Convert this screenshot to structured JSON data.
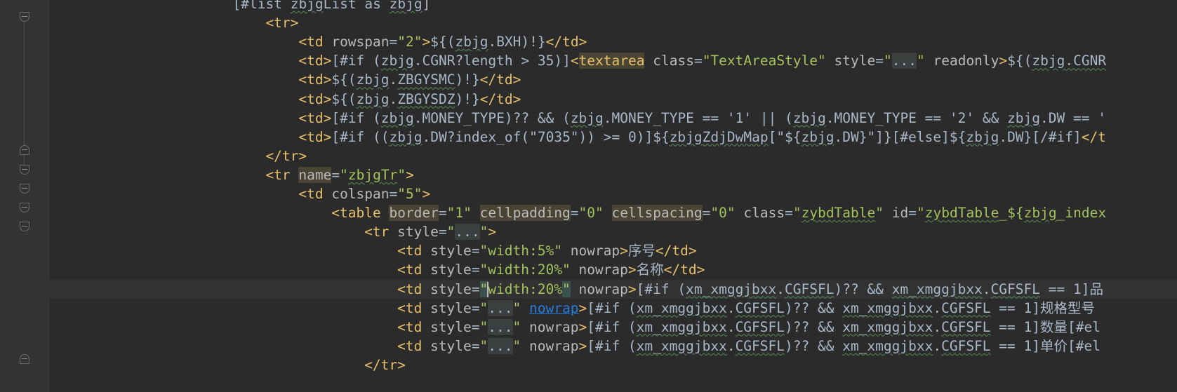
{
  "editor": {
    "lines": [
      {
        "indent": 12,
        "segments": [
          {
            "t": "[#list ",
            "c": "txt"
          },
          {
            "t": "zbjg",
            "c": "txt wavy"
          },
          {
            "t": "List as ",
            "c": "txt"
          },
          {
            "t": "zbjg",
            "c": "txt wavy"
          },
          {
            "t": "]",
            "c": "txt"
          }
        ]
      },
      {
        "indent": 14,
        "segments": [
          {
            "t": "<tr>",
            "c": "tag"
          }
        ]
      },
      {
        "indent": 16,
        "segments": [
          {
            "t": "<td ",
            "c": "tag"
          },
          {
            "t": "rowspan",
            "c": "attr"
          },
          {
            "t": "=",
            "c": "txt"
          },
          {
            "t": "\"2\"",
            "c": "str"
          },
          {
            "t": ">",
            "c": "tag"
          },
          {
            "t": "${(",
            "c": "txt"
          },
          {
            "t": "zbjg",
            "c": "txt wavy"
          },
          {
            "t": ".BXH)!}",
            "c": "txt"
          },
          {
            "t": "</td>",
            "c": "tag"
          }
        ]
      },
      {
        "indent": 16,
        "segments": [
          {
            "t": "<td>",
            "c": "tag"
          },
          {
            "t": "[#if (",
            "c": "txt"
          },
          {
            "t": "zbjg",
            "c": "txt wavy"
          },
          {
            "t": ".CGNR?length > 35)]",
            "c": "txt"
          },
          {
            "t": "<",
            "c": "tag"
          },
          {
            "t": "textarea",
            "c": "tag hl"
          },
          {
            "t": " ",
            "c": "tag"
          },
          {
            "t": "class",
            "c": "attr"
          },
          {
            "t": "=",
            "c": "txt"
          },
          {
            "t": "\"TextAreaStyle\"",
            "c": "str"
          },
          {
            "t": " ",
            "c": "txt"
          },
          {
            "t": "style",
            "c": "attr"
          },
          {
            "t": "=",
            "c": "txt"
          },
          {
            "t": "\"",
            "c": "str"
          },
          {
            "t": "...",
            "c": "fold-ph"
          },
          {
            "t": "\"",
            "c": "str"
          },
          {
            "t": " ",
            "c": "txt"
          },
          {
            "t": "readonly",
            "c": "attr"
          },
          {
            "t": ">",
            "c": "tag"
          },
          {
            "t": "${(",
            "c": "txt"
          },
          {
            "t": "zbjg",
            "c": "txt wavy"
          },
          {
            "t": ".CGNR",
            "c": "txt wavy"
          }
        ]
      },
      {
        "indent": 16,
        "segments": [
          {
            "t": "<td>",
            "c": "tag"
          },
          {
            "t": "${(",
            "c": "txt"
          },
          {
            "t": "zbjg",
            "c": "txt wavy"
          },
          {
            "t": ".",
            "c": "txt"
          },
          {
            "t": "ZBGYSMC",
            "c": "txt wavy"
          },
          {
            "t": ")!}",
            "c": "txt"
          },
          {
            "t": "</td>",
            "c": "tag"
          }
        ]
      },
      {
        "indent": 16,
        "segments": [
          {
            "t": "<td>",
            "c": "tag"
          },
          {
            "t": "${(",
            "c": "txt"
          },
          {
            "t": "zbjg",
            "c": "txt wavy"
          },
          {
            "t": ".",
            "c": "txt"
          },
          {
            "t": "ZBGYSDZ",
            "c": "txt wavy"
          },
          {
            "t": ")!}",
            "c": "txt"
          },
          {
            "t": "</td>",
            "c": "tag"
          }
        ]
      },
      {
        "indent": 16,
        "segments": [
          {
            "t": "<td>",
            "c": "tag"
          },
          {
            "t": "[#if (",
            "c": "txt"
          },
          {
            "t": "zbjg",
            "c": "txt wavy"
          },
          {
            "t": ".MONEY_TYPE)?? && (",
            "c": "txt"
          },
          {
            "t": "zbjg",
            "c": "txt wavy"
          },
          {
            "t": ".MONEY_TYPE == '1' || (",
            "c": "txt"
          },
          {
            "t": "zbjg",
            "c": "txt wavy"
          },
          {
            "t": ".MONEY_TYPE == '2' && ",
            "c": "txt"
          },
          {
            "t": "zbjg",
            "c": "txt wavy"
          },
          {
            "t": ".DW == '",
            "c": "txt"
          }
        ]
      },
      {
        "indent": 16,
        "segments": [
          {
            "t": "<td>",
            "c": "tag"
          },
          {
            "t": "[#if ((",
            "c": "txt"
          },
          {
            "t": "zbjg",
            "c": "txt wavy"
          },
          {
            "t": ".DW?index_of(\"7035\")) >= 0)]${",
            "c": "txt"
          },
          {
            "t": "zbjgZdjDwMap",
            "c": "txt wavy"
          },
          {
            "t": "[\"${",
            "c": "txt"
          },
          {
            "t": "zbjg",
            "c": "txt wavy"
          },
          {
            "t": ".DW}\"]}[#else]${",
            "c": "txt"
          },
          {
            "t": "zbjg",
            "c": "txt wavy"
          },
          {
            "t": ".DW}[/#if]",
            "c": "txt"
          },
          {
            "t": "</t",
            "c": "tag"
          }
        ]
      },
      {
        "indent": 14,
        "segments": [
          {
            "t": "</tr>",
            "c": "tag"
          }
        ]
      },
      {
        "indent": 14,
        "segments": [
          {
            "t": "<tr ",
            "c": "tag"
          },
          {
            "t": "name",
            "c": "attr hl"
          },
          {
            "t": "=",
            "c": "txt"
          },
          {
            "t": "\"",
            "c": "str"
          },
          {
            "t": "zbjgTr",
            "c": "str wavy"
          },
          {
            "t": "\"",
            "c": "str"
          },
          {
            "t": ">",
            "c": "tag"
          }
        ]
      },
      {
        "indent": 16,
        "segments": [
          {
            "t": "<td ",
            "c": "tag"
          },
          {
            "t": "colspan",
            "c": "attr"
          },
          {
            "t": "=",
            "c": "txt"
          },
          {
            "t": "\"5\"",
            "c": "str"
          },
          {
            "t": ">",
            "c": "tag"
          }
        ]
      },
      {
        "indent": 18,
        "segments": [
          {
            "t": "<table ",
            "c": "tag"
          },
          {
            "t": "border",
            "c": "attr hl"
          },
          {
            "t": "=",
            "c": "txt"
          },
          {
            "t": "\"1\"",
            "c": "str"
          },
          {
            "t": " ",
            "c": "txt"
          },
          {
            "t": "cellpadding",
            "c": "attr hl"
          },
          {
            "t": "=",
            "c": "txt"
          },
          {
            "t": "\"0\"",
            "c": "str"
          },
          {
            "t": " ",
            "c": "txt"
          },
          {
            "t": "cellspacing",
            "c": "attr hl"
          },
          {
            "t": "=",
            "c": "txt"
          },
          {
            "t": "\"0\"",
            "c": "str"
          },
          {
            "t": " ",
            "c": "txt"
          },
          {
            "t": "class",
            "c": "attr"
          },
          {
            "t": "=",
            "c": "txt"
          },
          {
            "t": "\"",
            "c": "str"
          },
          {
            "t": "zybdTable",
            "c": "str wavy"
          },
          {
            "t": "\"",
            "c": "str"
          },
          {
            "t": " ",
            "c": "txt"
          },
          {
            "t": "id",
            "c": "attr"
          },
          {
            "t": "=",
            "c": "txt"
          },
          {
            "t": "\"",
            "c": "str"
          },
          {
            "t": "zybdTable",
            "c": "str wavy"
          },
          {
            "t": "_${",
            "c": "str"
          },
          {
            "t": "zbjg",
            "c": "str wavy"
          },
          {
            "t": "_index",
            "c": "str"
          }
        ]
      },
      {
        "indent": 20,
        "segments": [
          {
            "t": "<tr ",
            "c": "tag"
          },
          {
            "t": "style",
            "c": "attr"
          },
          {
            "t": "=",
            "c": "txt"
          },
          {
            "t": "\"",
            "c": "str"
          },
          {
            "t": "...",
            "c": "fold-ph"
          },
          {
            "t": "\"",
            "c": "str"
          },
          {
            "t": ">",
            "c": "tag"
          }
        ]
      },
      {
        "indent": 22,
        "segments": [
          {
            "t": "<td ",
            "c": "tag"
          },
          {
            "t": "style",
            "c": "attr"
          },
          {
            "t": "=",
            "c": "txt"
          },
          {
            "t": "\"width:",
            "c": "str"
          },
          {
            "t": "5%",
            "c": "str"
          },
          {
            "t": "\"",
            "c": "str"
          },
          {
            "t": " ",
            "c": "txt"
          },
          {
            "t": "nowrap",
            "c": "attr"
          },
          {
            "t": ">",
            "c": "tag"
          },
          {
            "t": "序号",
            "c": "txt"
          },
          {
            "t": "</td>",
            "c": "tag"
          }
        ]
      },
      {
        "indent": 22,
        "segments": [
          {
            "t": "<td ",
            "c": "tag"
          },
          {
            "t": "style",
            "c": "attr"
          },
          {
            "t": "=",
            "c": "txt"
          },
          {
            "t": "\"width:",
            "c": "str"
          },
          {
            "t": "20%",
            "c": "str"
          },
          {
            "t": "\"",
            "c": "str"
          },
          {
            "t": " ",
            "c": "txt"
          },
          {
            "t": "nowrap",
            "c": "attr"
          },
          {
            "t": ">",
            "c": "tag"
          },
          {
            "t": "名称",
            "c": "txt"
          },
          {
            "t": "</td>",
            "c": "tag"
          }
        ]
      },
      {
        "indent": 22,
        "current": true,
        "segments": [
          {
            "t": "<td ",
            "c": "tag"
          },
          {
            "t": "style",
            "c": "attr"
          },
          {
            "t": "=",
            "c": "txt"
          },
          {
            "t": "\"",
            "c": "str brace-match"
          },
          {
            "t": "|",
            "c": "cursor"
          },
          {
            "t": "width:",
            "c": "str"
          },
          {
            "t": "20%",
            "c": "str"
          },
          {
            "t": "\"",
            "c": "str brace-match"
          },
          {
            "t": " ",
            "c": "txt"
          },
          {
            "t": "nowrap",
            "c": "attr"
          },
          {
            "t": ">",
            "c": "tag"
          },
          {
            "t": "[#if (",
            "c": "txt"
          },
          {
            "t": "xm_xmggjbxx",
            "c": "txt wavy"
          },
          {
            "t": ".",
            "c": "txt"
          },
          {
            "t": "CGFSFL",
            "c": "txt wavy"
          },
          {
            "t": ")?? && ",
            "c": "txt"
          },
          {
            "t": "xm_xmggjbxx",
            "c": "txt wavy"
          },
          {
            "t": ".",
            "c": "txt"
          },
          {
            "t": "CGFSFL",
            "c": "txt wavy"
          },
          {
            "t": " == 1]品",
            "c": "txt"
          }
        ]
      },
      {
        "indent": 22,
        "segments": [
          {
            "t": "<td ",
            "c": "tag"
          },
          {
            "t": "style",
            "c": "attr"
          },
          {
            "t": "=",
            "c": "txt"
          },
          {
            "t": "\"",
            "c": "str"
          },
          {
            "t": "...",
            "c": "fold-ph"
          },
          {
            "t": "\"",
            "c": "str"
          },
          {
            "t": " ",
            "c": "txt"
          },
          {
            "t": "nowrap",
            "c": "link"
          },
          {
            "t": ">",
            "c": "tag"
          },
          {
            "t": "[#if (",
            "c": "txt"
          },
          {
            "t": "xm_xmggjbxx",
            "c": "txt wavy"
          },
          {
            "t": ".",
            "c": "txt"
          },
          {
            "t": "CGFSFL",
            "c": "txt wavy"
          },
          {
            "t": ")?? && ",
            "c": "txt"
          },
          {
            "t": "xm_xmggjbxx",
            "c": "txt wavy"
          },
          {
            "t": ".",
            "c": "txt"
          },
          {
            "t": "CGFSFL",
            "c": "txt wavy"
          },
          {
            "t": " == 1]规格型号",
            "c": "txt"
          }
        ]
      },
      {
        "indent": 22,
        "segments": [
          {
            "t": "<td ",
            "c": "tag"
          },
          {
            "t": "style",
            "c": "attr"
          },
          {
            "t": "=",
            "c": "txt"
          },
          {
            "t": "\"",
            "c": "str"
          },
          {
            "t": "...",
            "c": "fold-ph"
          },
          {
            "t": "\"",
            "c": "str"
          },
          {
            "t": " ",
            "c": "txt"
          },
          {
            "t": "nowrap",
            "c": "attr"
          },
          {
            "t": ">",
            "c": "tag"
          },
          {
            "t": "[#if (",
            "c": "txt"
          },
          {
            "t": "xm_xmggjbxx",
            "c": "txt wavy"
          },
          {
            "t": ".",
            "c": "txt"
          },
          {
            "t": "CGFSFL",
            "c": "txt wavy"
          },
          {
            "t": ")?? && ",
            "c": "txt"
          },
          {
            "t": "xm_xmggjbxx",
            "c": "txt wavy"
          },
          {
            "t": ".",
            "c": "txt"
          },
          {
            "t": "CGFSFL",
            "c": "txt wavy"
          },
          {
            "t": " == 1]数量[#el",
            "c": "txt"
          }
        ]
      },
      {
        "indent": 22,
        "segments": [
          {
            "t": "<td ",
            "c": "tag"
          },
          {
            "t": "style",
            "c": "attr"
          },
          {
            "t": "=",
            "c": "txt"
          },
          {
            "t": "\"",
            "c": "str"
          },
          {
            "t": "...",
            "c": "fold-ph"
          },
          {
            "t": "\"",
            "c": "str"
          },
          {
            "t": " ",
            "c": "txt"
          },
          {
            "t": "nowrap",
            "c": "attr"
          },
          {
            "t": ">",
            "c": "tag"
          },
          {
            "t": "[#if (",
            "c": "txt"
          },
          {
            "t": "xm_xmggjbxx",
            "c": "txt wavy"
          },
          {
            "t": ".",
            "c": "txt"
          },
          {
            "t": "CGFSFL",
            "c": "txt wavy"
          },
          {
            "t": ")?? && ",
            "c": "txt"
          },
          {
            "t": "xm_xmggjbxx",
            "c": "txt wavy"
          },
          {
            "t": ".",
            "c": "txt"
          },
          {
            "t": "CGFSFL",
            "c": "txt wavy"
          },
          {
            "t": " == 1]单价[#el",
            "c": "txt"
          }
        ]
      },
      {
        "indent": 20,
        "segments": [
          {
            "t": "</tr>",
            "c": "tag"
          }
        ]
      }
    ]
  }
}
